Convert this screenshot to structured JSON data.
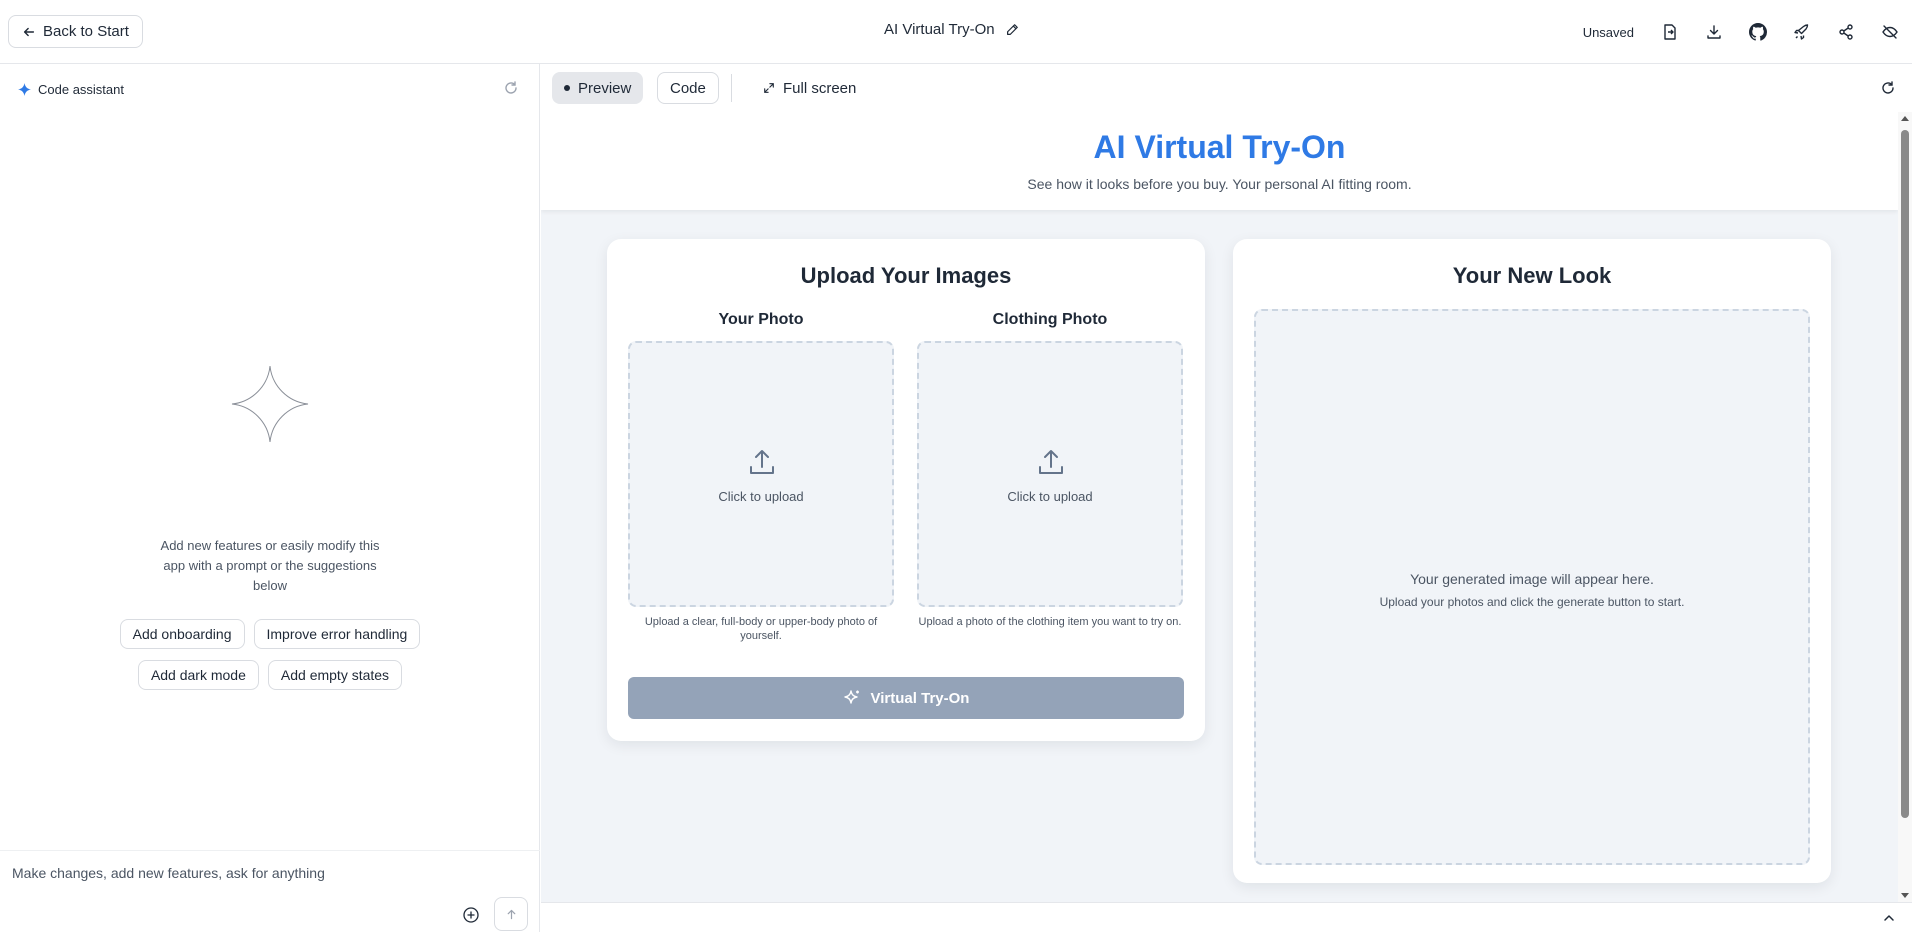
{
  "topbar": {
    "back_label": "Back to Start",
    "project_title": "AI Virtual Try-On",
    "status": "Unsaved",
    "icons": [
      "edit-icon",
      "export-icon",
      "download-icon",
      "github-icon",
      "deploy-rocket-icon",
      "share-icon",
      "hide-icon"
    ]
  },
  "assistant": {
    "title": "Code assistant",
    "helper_text": "Add new features or easily modify this app with a prompt or the suggestions below",
    "suggestions": [
      "Add onboarding",
      "Improve error handling",
      "Add dark mode",
      "Add empty states"
    ],
    "input_placeholder": "Make changes, add new features, ask for anything"
  },
  "preview_tabs": {
    "preview": "Preview",
    "code": "Code",
    "fullscreen": "Full screen"
  },
  "app": {
    "title": "AI Virtual Try-On",
    "subtitle": "See how it looks before you buy. Your personal AI fitting room.",
    "upload_card": {
      "title": "Upload Your Images",
      "your_photo": {
        "label": "Your Photo",
        "cta": "Click to upload",
        "hint": "Upload a clear, full-body or upper-body photo of yourself."
      },
      "clothing_photo": {
        "label": "Clothing Photo",
        "cta": "Click to upload",
        "hint": "Upload a photo of the clothing item you want to try on."
      },
      "button_label": "Virtual Try-On"
    },
    "result_card": {
      "title": "Your New Look",
      "placeholder_main": "Your generated image will appear here.",
      "placeholder_sub": "Upload your photos and click the generate button to start."
    }
  },
  "colors": {
    "accent": "#2f7ae5",
    "disabled_button": "#94a3b8",
    "preview_bg": "#f1f4f8"
  }
}
